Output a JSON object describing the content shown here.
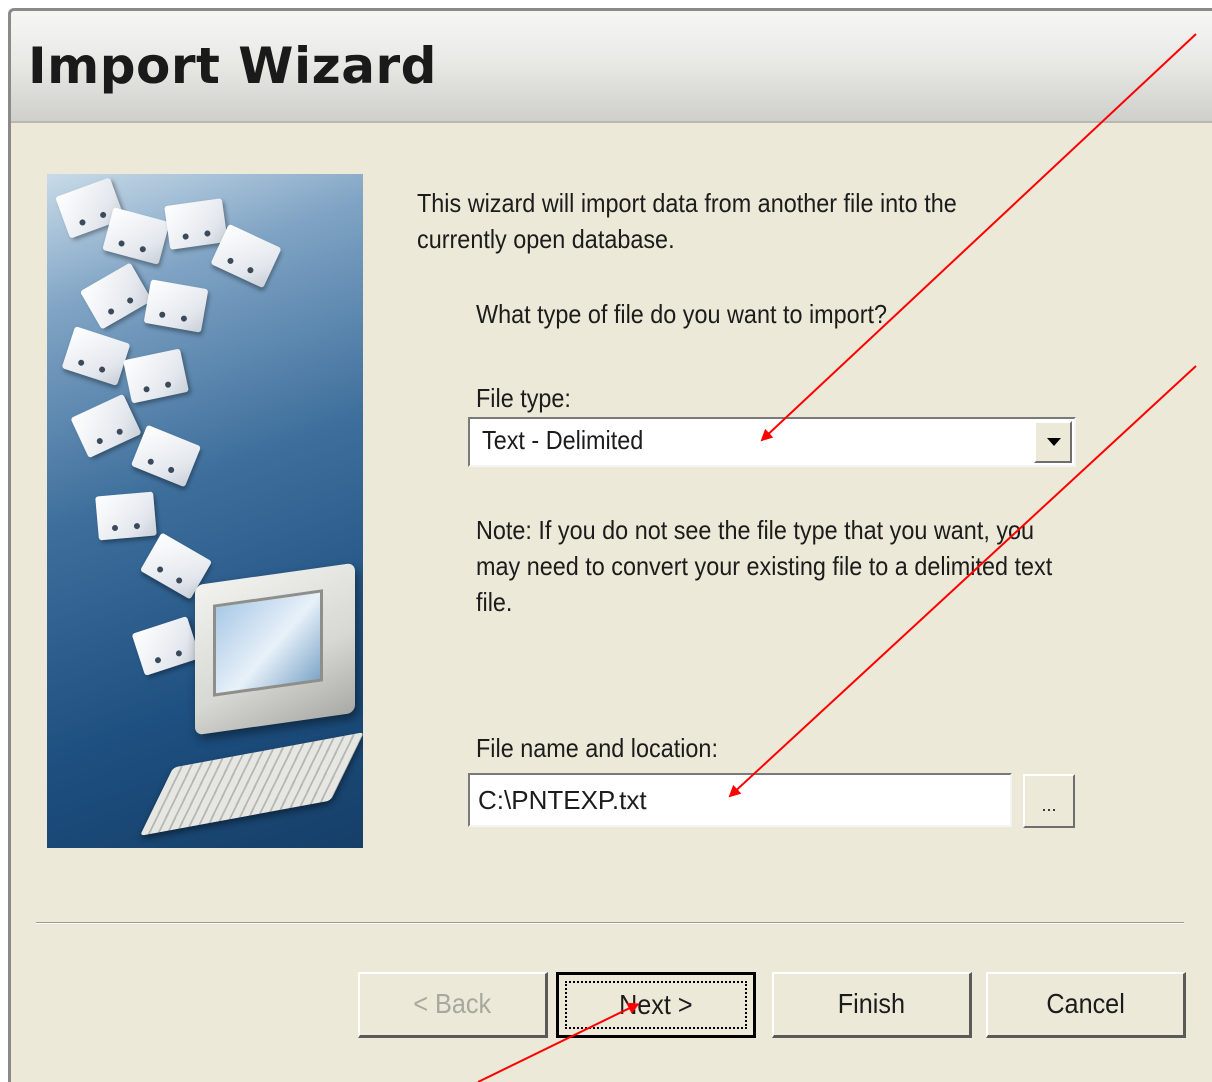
{
  "window": {
    "title": "Import Wizard"
  },
  "content": {
    "intro": "This wizard will import data from another file into the currently open database.",
    "question": "What type of file do you want to import?",
    "file_type_label": "File type:",
    "file_type_value": "Text - Delimited",
    "note": "Note:  If you do not see the file type that you want, you may need to convert your existing file to a delimited text file.",
    "file_name_label": "File name and location:",
    "file_name_value": "C:\\PNTEXP.txt",
    "browse_label": "..."
  },
  "buttons": {
    "back": "< Back",
    "next": "Next >",
    "finish": "Finish",
    "cancel": "Cancel"
  },
  "colors": {
    "annotation_arrow": "#ff0000",
    "dialog_background": "#ece9d8"
  },
  "icons": {
    "dropdown": "chevron-down-icon",
    "side_image": "import-wizard-illustration"
  }
}
